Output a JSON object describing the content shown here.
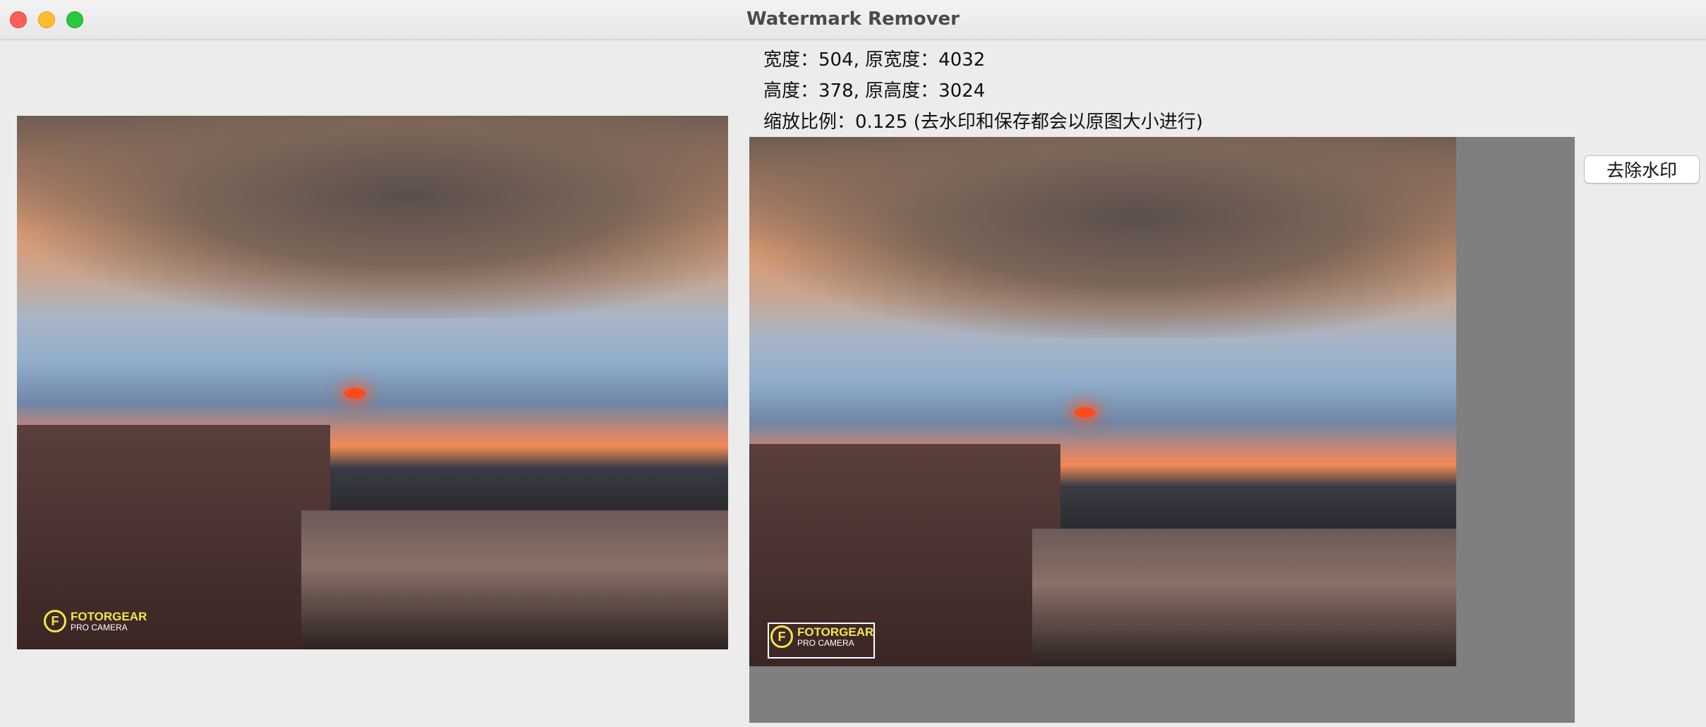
{
  "window": {
    "title": "Watermark Remover"
  },
  "info": {
    "width_line": "宽度：504, 原宽度：4032",
    "height_line": "高度：378, 原高度：3024",
    "scale_line": "缩放比例：0.125 (去水印和保存都会以原图大小进行)"
  },
  "watermark": {
    "brand": "FOTORGEAR",
    "sub": "PRO CAMERA",
    "logo": "F"
  },
  "actions": {
    "remove_label": "去除水印"
  },
  "colors": {
    "canvas_bg": "#7f7f7f",
    "watermark_text": "#f2e64a",
    "selection_border": "#ffffff"
  }
}
